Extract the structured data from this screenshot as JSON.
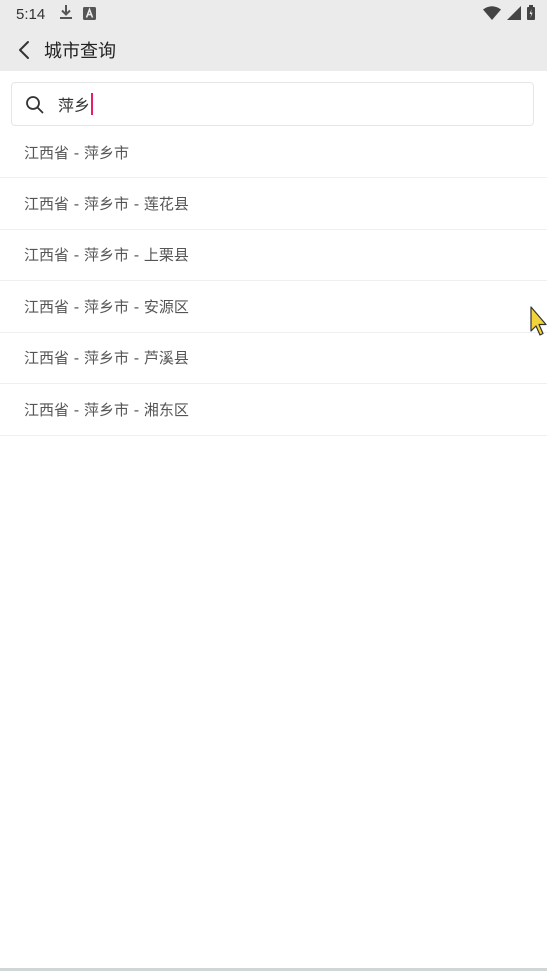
{
  "status_bar": {
    "time": "5:14",
    "left_icons": [
      "download-icon",
      "a-badge-icon"
    ],
    "right_icons": [
      "wifi-icon",
      "signal-icon",
      "battery-icon"
    ]
  },
  "app_bar": {
    "title": "城市查询"
  },
  "search": {
    "value": "萍乡",
    "caret_color": "#e91e63"
  },
  "results": [
    {
      "label": "江西省 - 萍乡市"
    },
    {
      "label": "江西省 - 萍乡市 - 莲花县"
    },
    {
      "label": "江西省 - 萍乡市 - 上栗县"
    },
    {
      "label": "江西省 - 萍乡市 - 安源区"
    },
    {
      "label": "江西省 - 萍乡市 - 芦溪县"
    },
    {
      "label": "江西省 - 萍乡市 - 湘东区"
    }
  ],
  "colors": {
    "bar_background": "#ebebeb",
    "accent_caret": "#e91e63",
    "result_text": "#555555"
  }
}
